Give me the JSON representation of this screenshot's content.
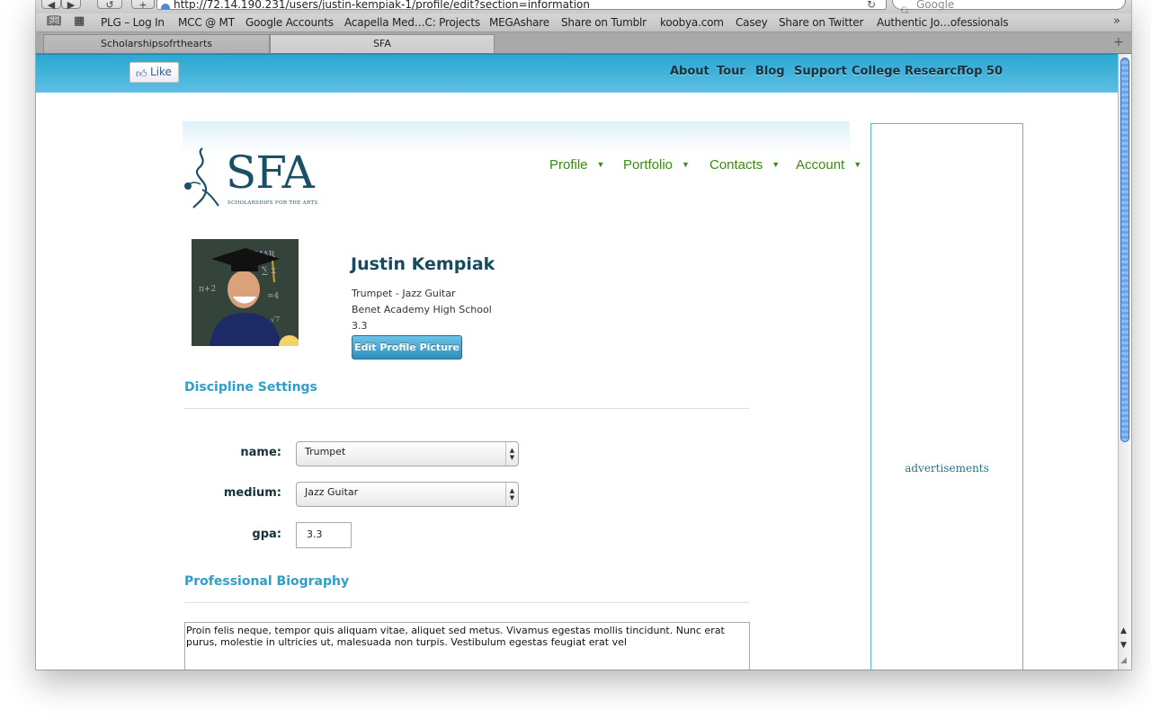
{
  "browser": {
    "url": "http://72.14.190.231/users/justin-kempiak-1/profile/edit?section=information",
    "search_placeholder": "Google",
    "add_symbol": "+",
    "bookmarks": [
      "PLG – Log In",
      "MCC @ MT",
      "Google Accounts",
      "Acapella Med…C: Projects",
      "MEGAshare",
      "Share on Tumblr",
      "koobya.com",
      "Casey",
      "Share on Twitter",
      "Authentic Jo…ofessionals"
    ],
    "tabs": [
      "Scholarshipsofrthearts",
      "SFA"
    ]
  },
  "site_header": {
    "like_label": "Like",
    "nav": [
      "About",
      "Tour",
      "Blog",
      "Support",
      "College Research",
      "Top 50"
    ]
  },
  "logo": {
    "text": "SFA",
    "tagline": "SCHOLARSHIPS FOR THE ARTS"
  },
  "main_nav": [
    "Profile",
    "Portfolio",
    "Contacts",
    "Account"
  ],
  "profile": {
    "name": "Justin Kempiak",
    "disciplines": "Trumpet - Jazz Guitar",
    "school": "Benet Academy High School",
    "gpa": "3.3",
    "edit_picture_label": "Edit Profile Picture"
  },
  "discipline_settings": {
    "title": "Discipline Settings",
    "name_label": "name:",
    "name_value": "Trumpet",
    "medium_label": "medium:",
    "medium_value": "Jazz Guitar",
    "gpa_label": "gpa:",
    "gpa_value": "3.3"
  },
  "biography": {
    "title": "Professional Biography",
    "text": "Proin felis neque, tempor quis aliquam vitae, aliquet sed metus. Vivamus egestas mollis tincidunt. Nunc erat purus, molestie in ultricies ut, malesuada non turpis. Vestibulum egestas feugiat erat vel"
  },
  "sidebar": {
    "ad_label": "advertisements"
  },
  "colors": {
    "header_blue": "#2ba7d2",
    "section_title": "#2f9fc9",
    "nav_green": "#3b8a13",
    "name_color": "#174a5e"
  }
}
